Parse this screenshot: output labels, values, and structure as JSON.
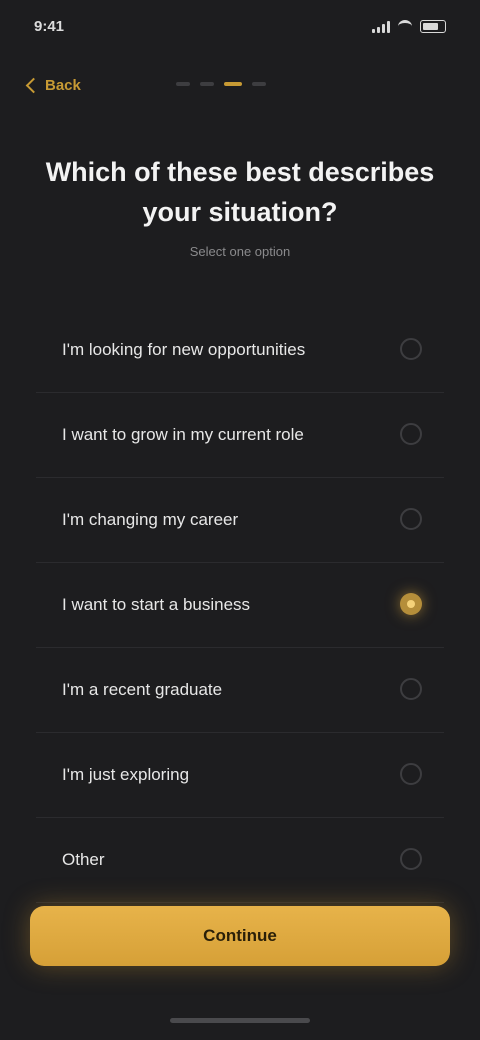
{
  "status_bar": {
    "time": "9:41"
  },
  "top_bar": {
    "back_label": "Back",
    "progress": {
      "total_steps": 4,
      "current_step": 3
    }
  },
  "question": {
    "title": "Which of these best describes your situation?",
    "subtitle": "Select one option"
  },
  "options": [
    {
      "label": "I'm looking for new opportunities",
      "selected": false
    },
    {
      "label": "I want to grow in my current role",
      "selected": false
    },
    {
      "label": "I'm changing my career",
      "selected": false
    },
    {
      "label": "I want to start a business",
      "selected": true
    },
    {
      "label": "I'm a recent graduate",
      "selected": false
    },
    {
      "label": "I'm just exploring",
      "selected": false
    },
    {
      "label": "Other",
      "selected": false
    }
  ],
  "continue_label": "Continue",
  "colors": {
    "accent": "#d9a63e",
    "background": "#1d1d1f"
  }
}
